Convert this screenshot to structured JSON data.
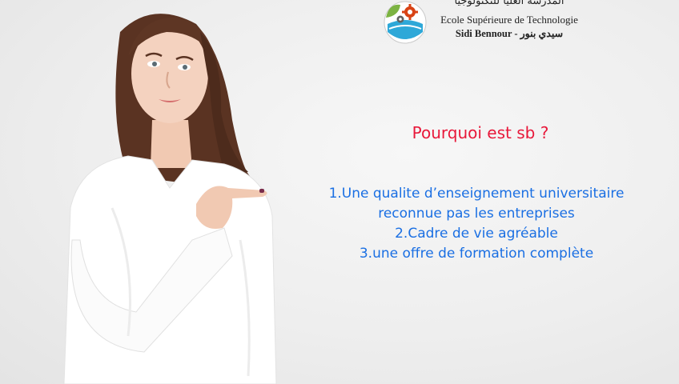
{
  "logo": {
    "arabic_title": "المدرسة العليا للتكنولوجيا",
    "name_fr": "Ecole Supérieure de Technologie",
    "city": "Sidi Bennour - سيدي بنور"
  },
  "question": "Pourquoi est sb ?",
  "reasons": [
    "1.Une qualite d’enseignement universitaire",
    "reconnue pas les entreprises",
    "2.Cadre de vie agréable",
    "3.une offre de formation complète"
  ],
  "colors": {
    "question": "#e8183a",
    "reasons": "#1a6fe3",
    "background": "#eeeeee"
  }
}
